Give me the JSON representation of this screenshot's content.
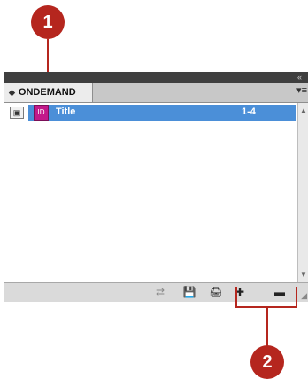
{
  "callouts": {
    "one": "1",
    "two": "2"
  },
  "panel": {
    "collapse_glyph": "«",
    "tab_label": "ONDEMAND",
    "tab_arrows": "◆",
    "menu_glyph": "▾≡"
  },
  "book_list": {
    "rows": [
      {
        "toggle_glyph": "▣",
        "icon_glyph": "ID",
        "name": "Title",
        "pages": "1-4"
      }
    ]
  },
  "toolbar": {
    "sync_glyph": "⇄",
    "save_glyph": "💾",
    "print_glyph": "🖨",
    "add_glyph": "✚",
    "remove_glyph": "▬"
  },
  "scroll": {
    "up": "▲",
    "down": "▼"
  }
}
